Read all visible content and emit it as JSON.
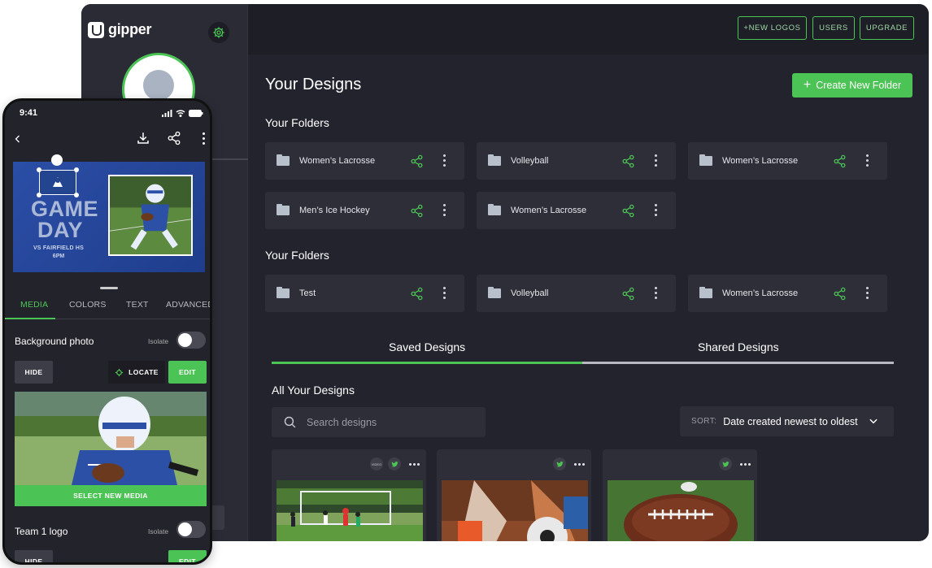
{
  "desktop": {
    "brand": "gipper",
    "topbar": {
      "new_logos": "+NEW LOGOS",
      "users": "USERS",
      "upgrade": "UPGRADE"
    },
    "title": "Your Designs",
    "create_folder": "Create New Folder",
    "folders_heading_1": "Your Folders",
    "folders_1": [
      "Women’s Lacrosse",
      "Volleyball",
      "Women’s Lacrosse",
      "Men’s Ice Hockey",
      "Women’s Lacrosse"
    ],
    "folders_heading_2": "Your Folders",
    "folders_2": [
      "Test",
      "Volleyball",
      "Women’s Lacrosse"
    ],
    "tabs": {
      "saved": "Saved Designs",
      "shared": "Shared Designs"
    },
    "all_heading": "All Your Designs",
    "search_placeholder": "Search designs",
    "sort_label": "SORT:",
    "sort_value": "Date created newest to oldest",
    "card_badge_video": "VIDEO",
    "colors": {
      "accent": "#4cc455",
      "bg": "#23232d",
      "panel": "#2e2e38"
    }
  },
  "phone": {
    "time": "9:41",
    "hero": {
      "line1": "GAME",
      "line2": "DAY",
      "subtitle": "VS FAIRFIELD HS",
      "time": "6PM"
    },
    "tabs": [
      "MEDIA",
      "COLORS",
      "TEXT",
      "ADVANCED"
    ],
    "background_photo": "Background photo",
    "isolate": "Isolate",
    "hide": "HIDE",
    "locate": "LOCATE",
    "edit": "EDIT",
    "select_media": "SELECT NEW MEDIA",
    "team_logo": "Team 1 logo",
    "isolate2": "Isolate",
    "hide2": "HIDE",
    "edit2": "EDIT"
  }
}
